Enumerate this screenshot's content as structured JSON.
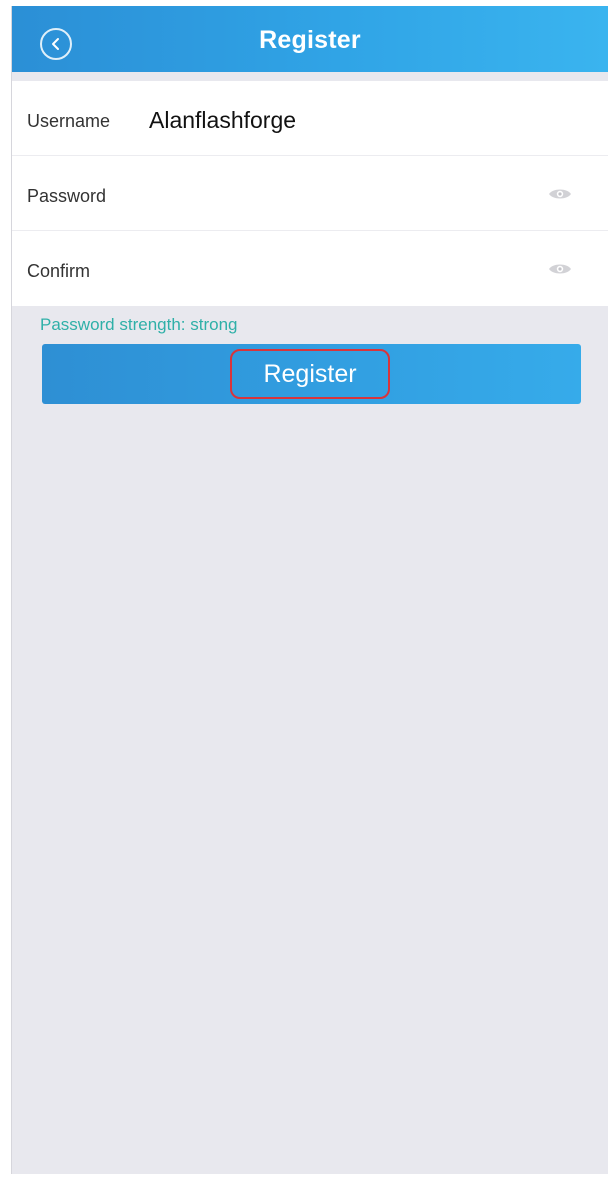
{
  "navbar": {
    "title": "Register",
    "back_icon": "chevron-left-icon",
    "gradient_colors": [
      "#2b8fd6",
      "#3ab4ef"
    ]
  },
  "form": {
    "username": {
      "label": "Username",
      "value": "Alanflashforge"
    },
    "password": {
      "label": "Password",
      "value": "",
      "icon": "eye-icon"
    },
    "confirm": {
      "label": "Confirm",
      "value": "",
      "icon": "eye-icon"
    }
  },
  "strength": {
    "text": "Password strength: strong",
    "color": "#2fb0a8"
  },
  "register_button": {
    "label": "Register",
    "highlight_color": "#d8343b"
  }
}
